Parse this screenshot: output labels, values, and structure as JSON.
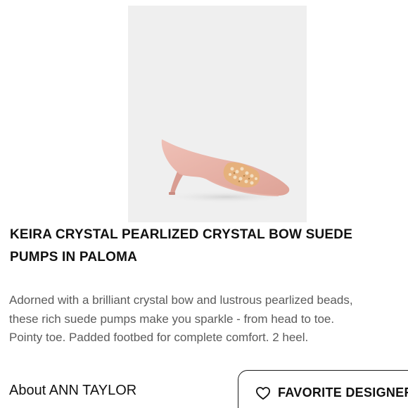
{
  "product": {
    "title_lines": [
      "KEIRA CRYSTAL PEARLIZED CRYSTAL BOW SUEDE",
      "PUMPS IN PALOMA"
    ],
    "description_lines": [
      "Adorned with a brilliant crystal bow and lustrous pearlized beads,",
      "these rich suede pumps make you sparkle - from head to toe.",
      "Pointy toe. Padded footbed for complete comfort. 2 heel."
    ],
    "image_icon": "pink-suede-pump-photo",
    "shoe_color": "#e9b4aa",
    "image_bg": "#efefef"
  },
  "footer": {
    "about_label": "About ANN TAYLOR",
    "favorite_button_label": "FAVORITE DESIGNER",
    "favorite_icon": "heart-outline-icon"
  }
}
